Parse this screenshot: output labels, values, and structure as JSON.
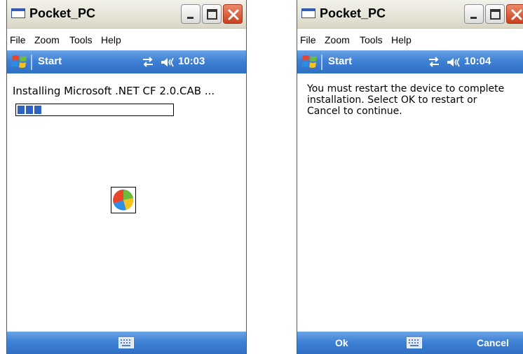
{
  "left_window": {
    "title": "Pocket_PC",
    "menu": [
      "File",
      "Zoom",
      "Tools",
      "Help"
    ],
    "taskbar": {
      "start_label": "Start",
      "clock": "10:03"
    },
    "install_label": "Installing Microsoft .NET CF 2.0.CAB ...",
    "progress_fraction": 0.17
  },
  "right_window": {
    "title": "Pocket_PC",
    "menu": [
      "File",
      "Zoom",
      "Tools",
      "Help"
    ],
    "taskbar": {
      "start_label": "Start",
      "clock": "10:04"
    },
    "message": "You must restart the device to complete installation. Select OK to restart or Cancel to continue.",
    "softkeys": {
      "left": "Ok",
      "right": "Cancel"
    }
  },
  "icons": {
    "title": "window-icon",
    "start": "windows-flag-icon",
    "connectivity": "connectivity-icon",
    "volume": "volume-icon",
    "input": "keyboard-icon",
    "busy": "wait-wheel-icon"
  },
  "colors": {
    "taskbar_blue": "#3f81d4",
    "progress_blue": "#2f62c0",
    "close_red": "#c9401e"
  }
}
